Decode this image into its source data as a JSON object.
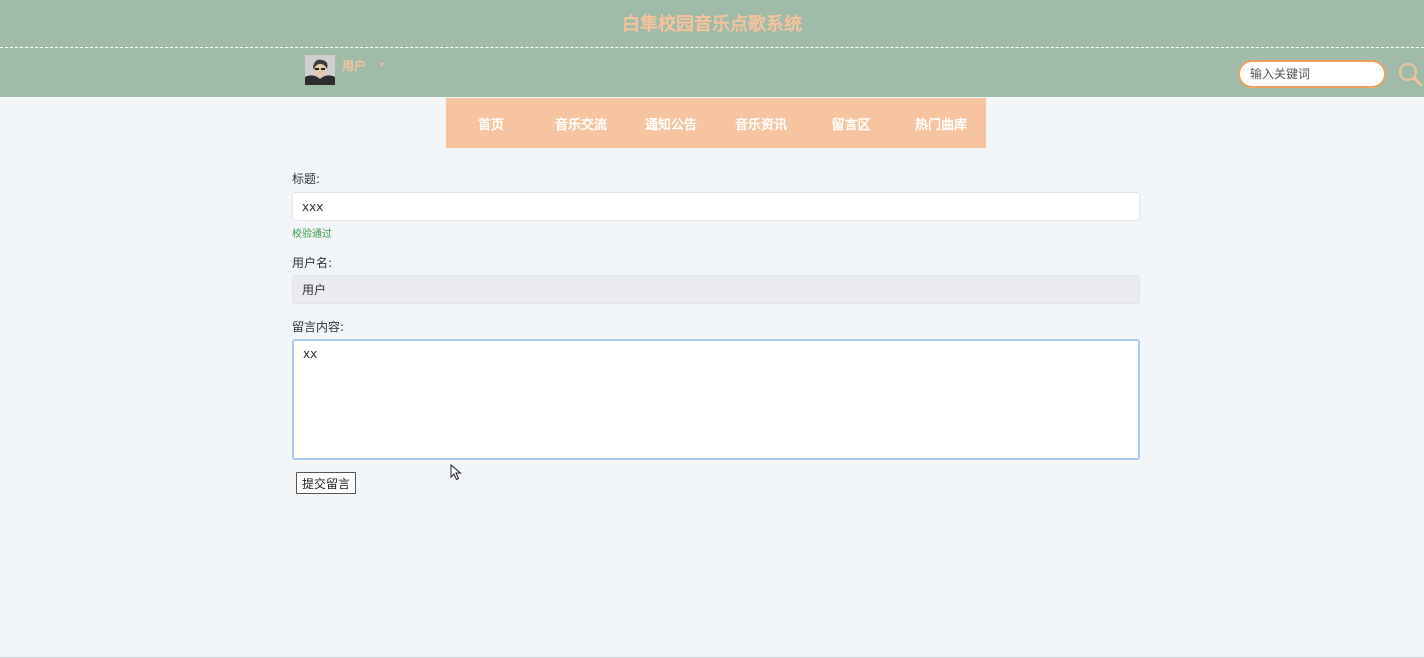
{
  "header": {
    "site_title": "白隼校园音乐点歌系统",
    "user_name": "用户",
    "user_caret": "▾",
    "search_placeholder": "输入关键词"
  },
  "nav": {
    "items": [
      "首页",
      "音乐交流",
      "通知公告",
      "音乐资讯",
      "留言区",
      "热门曲库"
    ]
  },
  "form": {
    "title_label": "标题:",
    "title_value": "xxx",
    "title_validation": "校验通过",
    "username_label": "用户名:",
    "username_value": "用户",
    "content_label": "留言内容:",
    "content_value": "xx",
    "submit_label": "提交留言"
  },
  "colors": {
    "header_bg": "#a0bca8",
    "accent": "#f7c4a2",
    "title_text": "#f6c39c",
    "search_border": "#e9a15f",
    "valid": "#3a9a4a"
  },
  "icons": {
    "search": "search-icon",
    "avatar": "avatar",
    "cursor": "mouse-cursor-icon"
  }
}
